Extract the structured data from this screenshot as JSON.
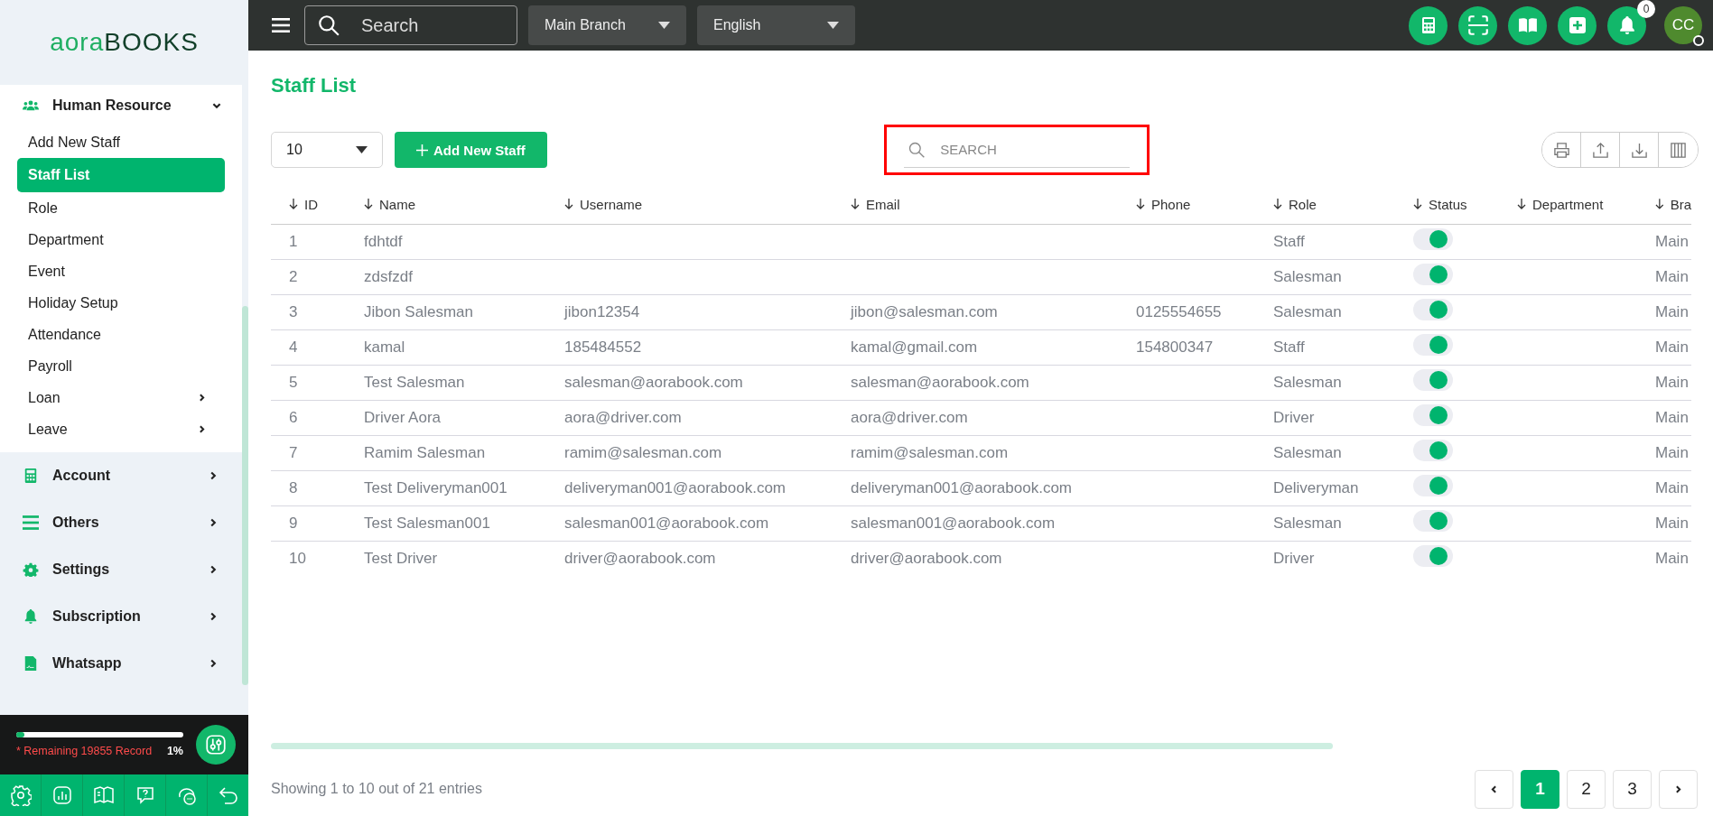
{
  "logo": {
    "part1": "aora",
    "part2": "BOOKS"
  },
  "sidebar": {
    "group": {
      "label": "Human Resource",
      "expanded": true,
      "children": [
        {
          "label": "Add New Staff",
          "selected": false,
          "has_submenu": false
        },
        {
          "label": "Staff List",
          "selected": true,
          "has_submenu": false
        },
        {
          "label": "Role",
          "selected": false,
          "has_submenu": false
        },
        {
          "label": "Department",
          "selected": false,
          "has_submenu": false
        },
        {
          "label": "Event",
          "selected": false,
          "has_submenu": false
        },
        {
          "label": "Holiday Setup",
          "selected": false,
          "has_submenu": false
        },
        {
          "label": "Attendance",
          "selected": false,
          "has_submenu": false
        },
        {
          "label": "Payroll",
          "selected": false,
          "has_submenu": false
        },
        {
          "label": "Loan",
          "selected": false,
          "has_submenu": true
        },
        {
          "label": "Leave",
          "selected": false,
          "has_submenu": true
        }
      ]
    },
    "sections": [
      {
        "label": "Account",
        "kind": "calculator"
      },
      {
        "label": "Others",
        "kind": "list"
      },
      {
        "label": "Settings",
        "kind": "gear"
      },
      {
        "label": "Subscription",
        "kind": "bell"
      },
      {
        "label": "Whatsapp",
        "kind": "document"
      }
    ]
  },
  "usage": {
    "level": 0.01,
    "text": "* Remaining 19855 Record",
    "percent": "1%"
  },
  "topbar": {
    "search": {
      "placeholder": "Search"
    },
    "branch": "Main Branch",
    "language": "English",
    "notifications": "0",
    "avatar": "CC"
  },
  "page": {
    "title": "Staff List",
    "page_size": "10",
    "add_button": "Add New Staff",
    "search": {
      "placeholder": "SEARCH"
    }
  },
  "table": {
    "columns": [
      "ID",
      "Name",
      "Username",
      "Email",
      "Phone",
      "Role",
      "Status",
      "Department",
      "Bra"
    ],
    "rows": [
      {
        "id": "1",
        "name": "fdhtdf",
        "role": "Staff",
        "active": true,
        "branch": "Main"
      },
      {
        "id": "2",
        "name": "zdsfzdf",
        "role": "Salesman",
        "active": true,
        "branch": "Main"
      },
      {
        "id": "3",
        "name": "Jibon Salesman",
        "username": "jibon12354",
        "email": "jibon@salesman.com",
        "phone": "0125554655",
        "role": "Salesman",
        "active": true,
        "branch": "Main"
      },
      {
        "id": "4",
        "name": "kamal",
        "username": "185484552",
        "email": "kamal@gmail.com",
        "phone": "154800347",
        "role": "Staff",
        "active": true,
        "branch": "Main"
      },
      {
        "id": "5",
        "name": "Test Salesman",
        "username": "salesman@aorabook.com",
        "email": "salesman@aorabook.com",
        "role": "Salesman",
        "active": true,
        "branch": "Main"
      },
      {
        "id": "6",
        "name": "Driver Aora",
        "username": "aora@driver.com",
        "email": "aora@driver.com",
        "role": "Driver",
        "active": true,
        "branch": "Main"
      },
      {
        "id": "7",
        "name": "Ramim Salesman",
        "username": "ramim@salesman.com",
        "email": "ramim@salesman.com",
        "role": "Salesman",
        "active": true,
        "branch": "Main"
      },
      {
        "id": "8",
        "name": "Test Deliveryman001",
        "username": "deliveryman001@aorabook.com",
        "email": "deliveryman001@aorabook.com",
        "role": "Deliveryman",
        "active": true,
        "branch": "Main"
      },
      {
        "id": "9",
        "name": "Test Salesman001",
        "username": "salesman001@aorabook.com",
        "email": "salesman001@aorabook.com",
        "role": "Salesman",
        "active": true,
        "branch": "Main"
      },
      {
        "id": "10",
        "name": "Test Driver",
        "username": "driver@aorabook.com",
        "email": "driver@aorabook.com",
        "role": "Driver",
        "active": true,
        "branch": "Main"
      }
    ]
  },
  "footer": {
    "info": "Showing 1 to 10 out of 21 entries",
    "pages": [
      {
        "label": "1",
        "selected": true
      },
      {
        "label": "2",
        "selected": false
      },
      {
        "label": "3",
        "selected": false
      }
    ]
  }
}
